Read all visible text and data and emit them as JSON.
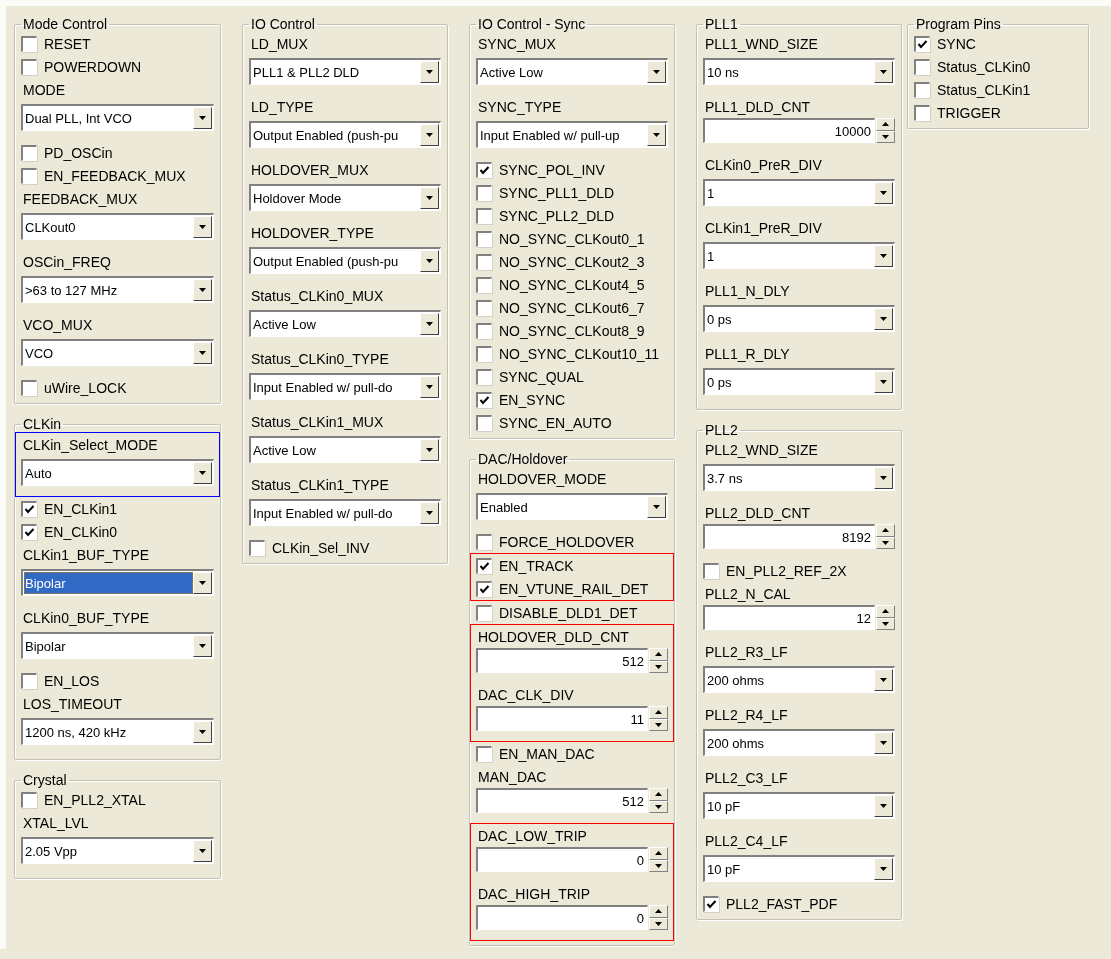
{
  "columns": [
    {
      "groups": [
        {
          "title": "Mode Control",
          "items": [
            {
              "kind": "check",
              "label": "RESET",
              "checked": false
            },
            {
              "kind": "check",
              "label": "POWERDOWN",
              "checked": false
            },
            {
              "kind": "combo",
              "label": "MODE",
              "value": "Dual PLL, Int VCO",
              "highlighted": false
            },
            {
              "kind": "check",
              "label": "PD_OSCin",
              "checked": false
            },
            {
              "kind": "check",
              "label": "EN_FEEDBACK_MUX",
              "checked": false
            },
            {
              "kind": "combo",
              "label": "FEEDBACK_MUX",
              "value": "CLKout0",
              "highlighted": false
            },
            {
              "kind": "combo",
              "label": "OSCin_FREQ",
              "value": ">63 to 127 MHz",
              "highlighted": false
            },
            {
              "kind": "combo",
              "label": "VCO_MUX",
              "value": "VCO",
              "highlighted": false
            },
            {
              "kind": "check",
              "label": "uWire_LOCK",
              "checked": false
            }
          ]
        },
        {
          "title": "CLKin",
          "items": [
            {
              "kind": "box",
              "color": "#0000ff",
              "items": [
                {
                  "kind": "combo",
                  "label": "CLKin_Select_MODE",
                  "value": "Auto",
                  "highlighted": false
                }
              ]
            },
            {
              "kind": "check",
              "label": "EN_CLKin1",
              "checked": true
            },
            {
              "kind": "check",
              "label": "EN_CLKin0",
              "checked": true
            },
            {
              "kind": "combo",
              "label": "CLKin1_BUF_TYPE",
              "value": "Bipolar",
              "highlighted": true
            },
            {
              "kind": "combo",
              "label": "CLKin0_BUF_TYPE",
              "value": "Bipolar",
              "highlighted": false
            },
            {
              "kind": "check",
              "label": "EN_LOS",
              "checked": false
            },
            {
              "kind": "combo",
              "label": "LOS_TIMEOUT",
              "value": "1200 ns, 420 kHz",
              "highlighted": false
            }
          ]
        },
        {
          "title": "Crystal",
          "items": [
            {
              "kind": "check",
              "label": "EN_PLL2_XTAL",
              "checked": false
            },
            {
              "kind": "combo",
              "label": "XTAL_LVL",
              "value": "2.05 Vpp",
              "highlighted": false
            }
          ]
        }
      ]
    },
    {
      "groups": [
        {
          "title": "IO Control",
          "items": [
            {
              "kind": "combo",
              "label": "LD_MUX",
              "value": "PLL1 & PLL2 DLD",
              "highlighted": false
            },
            {
              "kind": "combo",
              "label": "LD_TYPE",
              "value": "Output Enabled (push-pu",
              "highlighted": false
            },
            {
              "kind": "combo",
              "label": "HOLDOVER_MUX",
              "value": "Holdover Mode",
              "highlighted": false
            },
            {
              "kind": "combo",
              "label": "HOLDOVER_TYPE",
              "value": "Output Enabled (push-pu",
              "highlighted": false
            },
            {
              "kind": "combo",
              "label": "Status_CLKin0_MUX",
              "value": "Active Low",
              "highlighted": false
            },
            {
              "kind": "combo",
              "label": "Status_CLKin0_TYPE",
              "value": "Input Enabled w/ pull-do",
              "highlighted": false
            },
            {
              "kind": "combo",
              "label": "Status_CLKin1_MUX",
              "value": "Active Low",
              "highlighted": false
            },
            {
              "kind": "combo",
              "label": "Status_CLKin1_TYPE",
              "value": "Input Enabled w/ pull-do",
              "highlighted": false
            },
            {
              "kind": "check",
              "label": "CLKin_Sel_INV",
              "checked": false
            }
          ]
        }
      ]
    },
    {
      "groups": [
        {
          "title": "IO Control - Sync",
          "items": [
            {
              "kind": "combo",
              "label": "SYNC_MUX",
              "value": "Active Low",
              "highlighted": false
            },
            {
              "kind": "combo",
              "label": "SYNC_TYPE",
              "value": "Input Enabled w/ pull-up",
              "highlighted": false
            },
            {
              "kind": "check",
              "label": "SYNC_POL_INV",
              "checked": true
            },
            {
              "kind": "check",
              "label": "SYNC_PLL1_DLD",
              "checked": false
            },
            {
              "kind": "check",
              "label": "SYNC_PLL2_DLD",
              "checked": false
            },
            {
              "kind": "check",
              "label": "NO_SYNC_CLKout0_1",
              "checked": false
            },
            {
              "kind": "check",
              "label": "NO_SYNC_CLKout2_3",
              "checked": false
            },
            {
              "kind": "check",
              "label": "NO_SYNC_CLKout4_5",
              "checked": false
            },
            {
              "kind": "check",
              "label": "NO_SYNC_CLKout6_7",
              "checked": false
            },
            {
              "kind": "check",
              "label": "NO_SYNC_CLKout8_9",
              "checked": false
            },
            {
              "kind": "check",
              "label": "NO_SYNC_CLKout10_11",
              "checked": false
            },
            {
              "kind": "check",
              "label": "SYNC_QUAL",
              "checked": false
            },
            {
              "kind": "check",
              "label": "EN_SYNC",
              "checked": true
            },
            {
              "kind": "check",
              "label": "SYNC_EN_AUTO",
              "checked": false
            }
          ]
        },
        {
          "title": "DAC/Holdover",
          "items": [
            {
              "kind": "combo",
              "label": "HOLDOVER_MODE",
              "value": "Enabled",
              "highlighted": false
            },
            {
              "kind": "check",
              "label": "FORCE_HOLDOVER",
              "checked": false
            },
            {
              "kind": "box",
              "color": "#ff0000",
              "items": [
                {
                  "kind": "check",
                  "label": "EN_TRACK",
                  "checked": true
                },
                {
                  "kind": "check",
                  "label": "EN_VTUNE_RAIL_DET",
                  "checked": true
                }
              ]
            },
            {
              "kind": "check",
              "label": "DISABLE_DLD1_DET",
              "checked": false
            },
            {
              "kind": "box",
              "color": "#ff0000",
              "items": [
                {
                  "kind": "spin",
                  "label": "HOLDOVER_DLD_CNT",
                  "value": "512"
                },
                {
                  "kind": "spin",
                  "label": "DAC_CLK_DIV",
                  "value": "11"
                }
              ]
            },
            {
              "kind": "check",
              "label": "EN_MAN_DAC",
              "checked": false
            },
            {
              "kind": "spin",
              "label": "MAN_DAC",
              "value": "512"
            },
            {
              "kind": "box",
              "color": "#ff0000",
              "items": [
                {
                  "kind": "spin",
                  "label": "DAC_LOW_TRIP",
                  "value": "0"
                },
                {
                  "kind": "spin",
                  "label": "DAC_HIGH_TRIP",
                  "value": "0"
                }
              ]
            }
          ]
        }
      ]
    },
    {
      "groups": [
        {
          "title": "PLL1",
          "items": [
            {
              "kind": "combo",
              "label": "PLL1_WND_SIZE",
              "value": "10 ns",
              "highlighted": false
            },
            {
              "kind": "spin",
              "label": "PLL1_DLD_CNT",
              "value": "10000"
            },
            {
              "kind": "combo",
              "label": "CLKin0_PreR_DIV",
              "value": "1",
              "highlighted": false
            },
            {
              "kind": "combo",
              "label": "CLKin1_PreR_DIV",
              "value": "1",
              "highlighted": false
            },
            {
              "kind": "combo",
              "label": "PLL1_N_DLY",
              "value": "0 ps",
              "highlighted": false
            },
            {
              "kind": "combo",
              "label": "PLL1_R_DLY",
              "value": "0 ps",
              "highlighted": false
            }
          ]
        },
        {
          "title": "PLL2",
          "items": [
            {
              "kind": "combo",
              "label": "PLL2_WND_SIZE",
              "value": "3.7 ns",
              "highlighted": false
            },
            {
              "kind": "spin",
              "label": "PLL2_DLD_CNT",
              "value": "8192"
            },
            {
              "kind": "check",
              "text": "EN_PLL2_REF_2X",
              "checked": false
            },
            {
              "kind": "spin",
              "label": "PLL2_N_CAL",
              "value": "12"
            },
            {
              "kind": "combo",
              "label": "PLL2_R3_LF",
              "value": "200 ohms",
              "highlighted": false
            },
            {
              "kind": "combo",
              "label": "PLL2_R4_LF",
              "value": "200 ohms",
              "highlighted": false
            },
            {
              "kind": "combo",
              "label": "PLL2_C3_LF",
              "value": "10 pF",
              "highlighted": false
            },
            {
              "kind": "combo",
              "label": "PLL2_C4_LF",
              "value": "10 pF",
              "highlighted": false
            },
            {
              "kind": "check",
              "label": "PLL2_FAST_PDF",
              "checked": true
            }
          ]
        }
      ]
    },
    {
      "groups": [
        {
          "title": "Program Pins",
          "items": [
            {
              "kind": "check",
              "label": "SYNC",
              "checked": true
            },
            {
              "kind": "check",
              "label": "Status_CLKin0",
              "checked": false
            },
            {
              "kind": "check",
              "label": "Status_CLKin1",
              "checked": false
            },
            {
              "kind": "check",
              "label": "TRIGGER",
              "checked": false
            }
          ]
        }
      ]
    }
  ]
}
